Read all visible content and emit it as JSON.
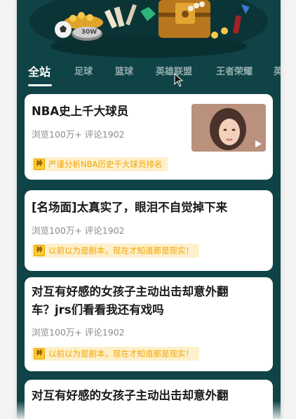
{
  "hero": {
    "badge_text": "30W"
  },
  "tabs": [
    {
      "label": "全站",
      "active": true
    },
    {
      "label": "足球"
    },
    {
      "label": "篮球"
    },
    {
      "label": "英雄联盟"
    },
    {
      "label": "王者荣耀"
    },
    {
      "label": "英"
    }
  ],
  "cards": [
    {
      "title": "NBA史上千大球员",
      "meta": "浏览100万+ 评论1902",
      "tag_badge": "神",
      "tag_text": "严谨分析NBA历史千大球员排名"
    },
    {
      "title": "[名场面]太真实了，眼泪不自觉掉下来",
      "meta": "浏览100万+ 评论1902",
      "tag_badge": "神",
      "tag_text": "以前以为是剧本，现在才知道那是现实！"
    },
    {
      "title_line1": "对互有好感的女孩子主动出击却意外翻",
      "title_line2": "车？jrs们看看我还有戏吗",
      "meta": "浏览100万+ 评论1902",
      "tag_badge": "神",
      "tag_text": "以前以为是剧本，现在才知道那是现实！"
    },
    {
      "title_line1": "对互有好感的女孩子主动出击却意外翻"
    }
  ],
  "colors": {
    "background": "#0f4346",
    "tag_bg": "#fdf0cc",
    "tag_text": "#f3a400"
  }
}
